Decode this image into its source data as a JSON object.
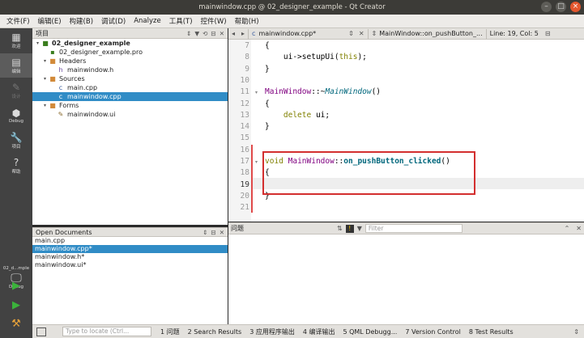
{
  "window": {
    "title": "mainwindow.cpp @ 02_designer_example - Qt Creator"
  },
  "menubar": [
    "文件(F)",
    "编辑(E)",
    "构建(B)",
    "调试(D)",
    "Analyze",
    "工具(T)",
    "控件(W)",
    "帮助(H)"
  ],
  "modes": [
    {
      "label": "欢迎",
      "icon": "▦"
    },
    {
      "label": "编辑",
      "icon": "▤"
    },
    {
      "label": "设计",
      "icon": "✎"
    },
    {
      "label": "Debug",
      "icon": "⬢"
    },
    {
      "label": "项目",
      "icon": "🔧"
    },
    {
      "label": "帮助",
      "icon": "?"
    }
  ],
  "kit": {
    "name": "02_d...mple",
    "label": "Debug"
  },
  "project_pane": {
    "title": "项目",
    "tree": [
      {
        "label": "02_designer_example",
        "icon": "project-folder-icon",
        "level": 0,
        "expanded": true
      },
      {
        "label": "02_designer_example.pro",
        "icon": "pro-file-icon",
        "level": 1
      },
      {
        "label": "Headers",
        "icon": "folder-icon",
        "level": 1,
        "expanded": true
      },
      {
        "label": "mainwindow.h",
        "icon": "header-file-icon",
        "level": 2
      },
      {
        "label": "Sources",
        "icon": "folder-icon",
        "level": 1,
        "expanded": true
      },
      {
        "label": "main.cpp",
        "icon": "cpp-file-icon",
        "level": 2
      },
      {
        "label": "mainwindow.cpp",
        "icon": "cpp-file-icon",
        "level": 2,
        "selected": true
      },
      {
        "label": "Forms",
        "icon": "folder-icon",
        "level": 1,
        "expanded": true
      },
      {
        "label": "mainwindow.ui",
        "icon": "ui-file-icon",
        "level": 2
      }
    ]
  },
  "open_documents": {
    "title": "Open Documents",
    "items": [
      {
        "label": "main.cpp"
      },
      {
        "label": "mainwindow.cpp*",
        "selected": true
      },
      {
        "label": "mainwindow.h*"
      },
      {
        "label": "mainwindow.ui*"
      }
    ]
  },
  "editor_toolbar": {
    "file": "mainwindow.cpp*",
    "symbol": "MainWindow::on_pushButton_...",
    "position": "Line: 19, Col: 5"
  },
  "editor": {
    "current_line": 19,
    "lines": [
      {
        "n": 7,
        "tokens": [
          [
            "{",
            ""
          ]
        ]
      },
      {
        "n": 8,
        "tokens": [
          [
            "    ui",
            ""
          ],
          [
            "->",
            "arr"
          ],
          [
            "setupUi",
            ""
          ],
          [
            "(",
            ""
          ],
          [
            "this",
            "kw"
          ],
          [
            ");",
            ""
          ]
        ]
      },
      {
        "n": 9,
        "tokens": [
          [
            "}",
            ""
          ]
        ]
      },
      {
        "n": 10,
        "tokens": []
      },
      {
        "n": 11,
        "tokens": [
          [
            "MainWindow",
            "cls"
          ],
          [
            "::~",
            ""
          ],
          [
            "MainWindow",
            "ifn"
          ],
          [
            "()",
            ""
          ]
        ]
      },
      {
        "n": 12,
        "tokens": [
          [
            "{",
            ""
          ]
        ]
      },
      {
        "n": 13,
        "tokens": [
          [
            "    ",
            ""
          ],
          [
            "delete",
            "kw"
          ],
          [
            " ui;",
            ""
          ]
        ]
      },
      {
        "n": 14,
        "tokens": [
          [
            "}",
            ""
          ]
        ]
      },
      {
        "n": 15,
        "tokens": []
      },
      {
        "n": 16,
        "tokens": []
      },
      {
        "n": 17,
        "tokens": [
          [
            "void",
            "kw"
          ],
          [
            " ",
            ""
          ],
          [
            "MainWindow",
            "cls"
          ],
          [
            "::",
            ""
          ],
          [
            "on_pushButton_clicked",
            "fn"
          ],
          [
            "()",
            ""
          ]
        ]
      },
      {
        "n": 18,
        "tokens": [
          [
            "{",
            ""
          ]
        ]
      },
      {
        "n": 19,
        "tokens": []
      },
      {
        "n": 20,
        "tokens": [
          [
            "}",
            ""
          ]
        ]
      },
      {
        "n": 21,
        "tokens": []
      }
    ]
  },
  "problems_pane": {
    "title": "问题",
    "filter_placeholder": "Filter"
  },
  "statusbar": {
    "locate_placeholder": "Type to locate (Ctrl...",
    "tabs": [
      "1 问题",
      "2 Search Results",
      "3 应用程序输出",
      "4 编译输出",
      "5 QML Debugg...",
      "7 Version Control",
      "8 Test Results"
    ]
  }
}
